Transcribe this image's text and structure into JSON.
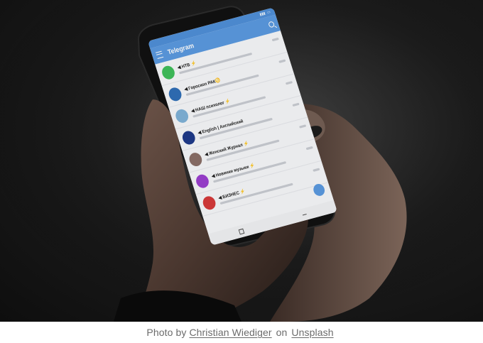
{
  "caption": {
    "prefix": "Photo by",
    "author": "Christian Wiediger",
    "middle": "on",
    "source": "Unsplash"
  },
  "phone_screen": {
    "app_title": "Telegram",
    "chats": [
      {
        "name": "◀ НТВ ⚡",
        "avatar_color": "#3fbf5a"
      },
      {
        "name": "◀ Гороскоп РАК♋",
        "avatar_color": "#2f6fb7"
      },
      {
        "name": "◀ НАШ психолог ⚡",
        "avatar_color": "#7fb2d8"
      },
      {
        "name": "◀ English | Английский",
        "avatar_color": "#1e3a8a"
      },
      {
        "name": "◀ Женский Журнал ⚡",
        "avatar_color": "#8a6f67"
      },
      {
        "name": "◀ Новинки музыки ⚡",
        "avatar_color": "#9b3fcf"
      },
      {
        "name": "◀ БИЗНЕС ⚡",
        "avatar_color": "#d63a3a"
      }
    ]
  },
  "colors": {
    "header": "#5b9ae0",
    "caption_text": "#6b6b6b"
  }
}
